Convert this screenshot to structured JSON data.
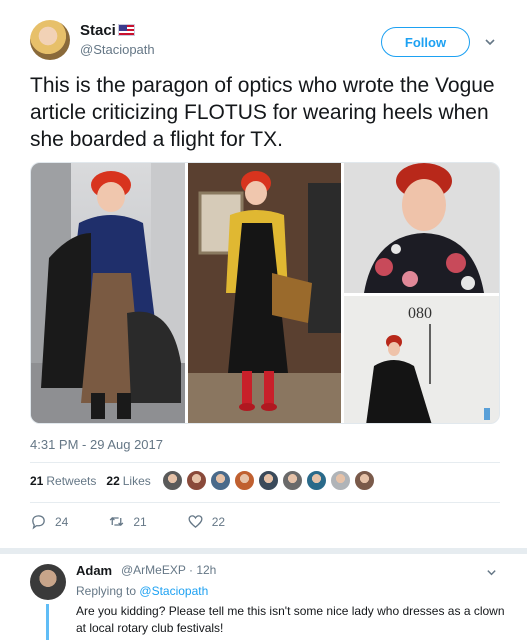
{
  "tweet": {
    "author_name": "Staci",
    "author_handle": "@Staciopath",
    "follow_label": "Follow",
    "text": "This is the paragon of optics who wrote the Vogue article criticizing FLOTUS for wearing heels when she boarded a flight for TX.",
    "timestamp": "4:31 PM - 29 Aug 2017",
    "retweets_count": "21",
    "retweets_label": "Retweets",
    "likes_count": "22",
    "likes_label": "Likes",
    "reply_count": "24",
    "retweet_action_count": "21",
    "like_action_count": "22",
    "media_sign_text": "080"
  },
  "likers": [
    "#5a5a5a",
    "#8a4a3a",
    "#4a6a8a",
    "#c06030",
    "#3a4a5a",
    "#6a6a6a",
    "#2a6a8a",
    "#b0b4b8",
    "#7a5a4a"
  ],
  "reply": {
    "author_name": "Adam",
    "author_handle": "@ArMeEXP",
    "time": "· 12h",
    "replying_prefix": "Replying to",
    "replying_handle": "@Staciopath",
    "text": "Are you kidding?  Please tell me this isn't some nice lady who dresses as a clown at local rotary club festivals!"
  },
  "colors": {
    "accent": "#1da1f2",
    "secondary_text": "#657786",
    "primary_text": "#14171a"
  }
}
